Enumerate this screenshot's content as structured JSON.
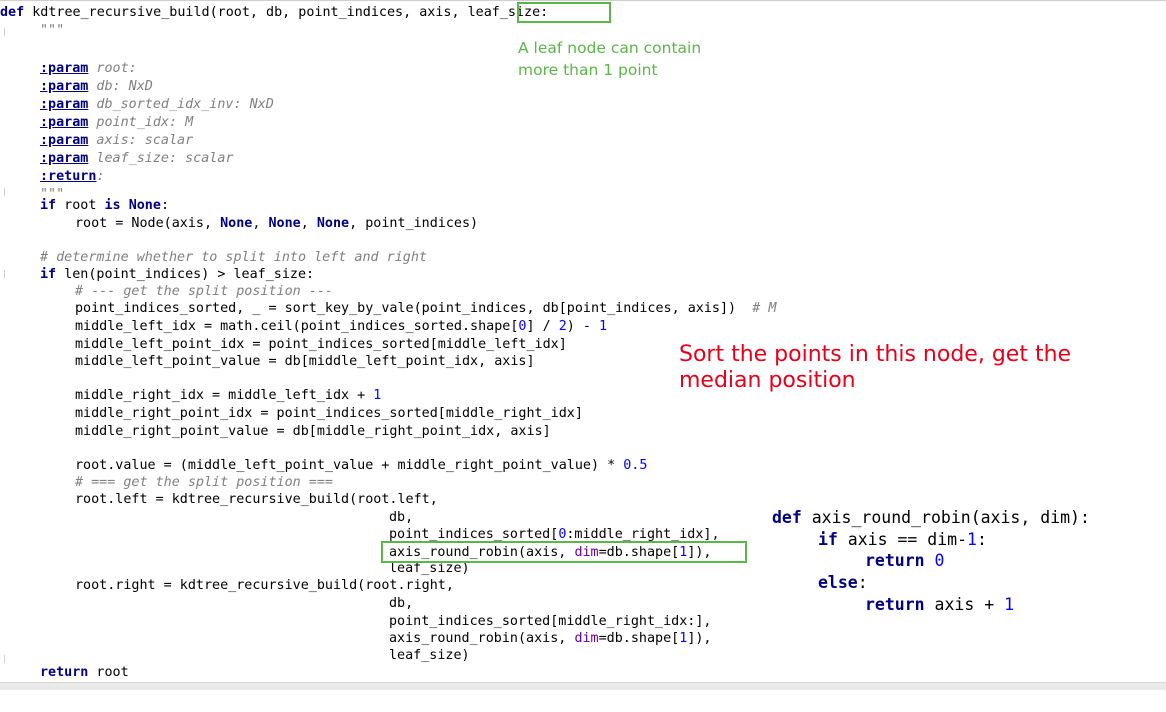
{
  "code": {
    "def_line": {
      "kw_def": "def",
      "sig_start": " kdtree_recursive_build(root, db, point_indices, axis, ",
      "param_boxed": "leaf_size",
      "sig_end": ":"
    },
    "docstring_open": "\"\"\"",
    "params": [
      {
        "tag": ":param",
        "text": " root:"
      },
      {
        "tag": ":param",
        "text": " db: NxD"
      },
      {
        "tag": ":param",
        "text": " db_sorted_idx_inv: NxD"
      },
      {
        "tag": ":param",
        "text": " point_idx: M"
      },
      {
        "tag": ":param",
        "text": " axis: scalar"
      },
      {
        "tag": ":param",
        "text": " leaf_size: scalar"
      }
    ],
    "return_tag": ":return",
    "return_text": ":",
    "docstring_close": "\"\"\"",
    "if_root": {
      "kw_if": "if",
      "mid": " root ",
      "kw_is": "is",
      "sp": " ",
      "kw_none": "None",
      "end": ":"
    },
    "root_node": {
      "a": "root = Node(axis, ",
      "n1": "None",
      "c1": ", ",
      "n2": "None",
      "c2": ", ",
      "n3": "None",
      "b": ", point_indices)"
    },
    "comment_determine": "# determine whether to split into left and right",
    "if_len": {
      "kw_if": "if",
      "rest": " len(point_indices) > leaf_size:"
    },
    "comment_split_1": "# --- get the split position ---",
    "sort_line": {
      "code": "point_indices_sorted, _ = sort_key_by_vale(point_indices, db[point_indices, axis])  ",
      "comment": "# M"
    },
    "mli_line": {
      "a": "middle_left_idx = math.ceil(point_indices_sorted.shape[",
      "n0": "0",
      "b": "] / ",
      "n2": "2",
      "c": ") - ",
      "n1": "1"
    },
    "mlpi_line": "middle_left_point_idx = point_indices_sorted[middle_left_idx]",
    "mlpv_line": "middle_left_point_value = db[middle_left_point_idx, axis]",
    "mri_line": {
      "a": "middle_right_idx = middle_left_idx + ",
      "n1": "1"
    },
    "mrpi_line": "middle_right_point_idx = point_indices_sorted[middle_right_idx]",
    "mrpv_line": "middle_right_point_value = db[middle_right_point_idx, axis]",
    "rv_line": {
      "a": "root.value = (middle_left_point_value + middle_right_point_value) * ",
      "n": "0.5"
    },
    "comment_split_2": "# === get the split position ===",
    "left_call": "root.left = kdtree_recursive_build(root.left,",
    "left_db": "db,",
    "left_slice": {
      "a": "point_indices_sorted[",
      "n": "0",
      "b": ":middle_right_idx],"
    },
    "left_robin": {
      "a": "axis_round_robin(axis, ",
      "kw": "dim",
      "b": "=db.shape[",
      "n": "1",
      "c": "]),"
    },
    "left_leaf": "leaf_size)",
    "right_call": "root.right = kdtree_recursive_build(root.right,",
    "right_db": "db,",
    "right_slice": "point_indices_sorted[middle_right_idx:],",
    "right_robin": {
      "a": "axis_round_robin(axis, ",
      "kw": "dim",
      "b": "=db.shape[",
      "n": "1",
      "c": "]),"
    },
    "right_leaf": "leaf_size)",
    "return_line": {
      "kw": "return",
      "rest": " root"
    }
  },
  "annotations": {
    "green_note_line1": "A leaf node can contain",
    "green_note_line2": "more than 1 point",
    "red_note_line1": "Sort the points in this node, get the",
    "red_note_line2": "median position",
    "box_color": "#5cb548",
    "red_color": "#e8001a"
  },
  "side_code": {
    "def_kw": "def",
    "def_rest": " axis_round_robin(axis, dim):",
    "if_kw": "if",
    "if_rest_a": " axis == dim-",
    "if_num": "1",
    "if_rest_b": ":",
    "ret_kw": "return",
    "ret_num_sp": " ",
    "ret_num": "0",
    "else_kw": "else",
    "else_colon": ":",
    "ret2_kw": "return",
    "ret2_rest": " axis + ",
    "ret2_num": "1"
  }
}
